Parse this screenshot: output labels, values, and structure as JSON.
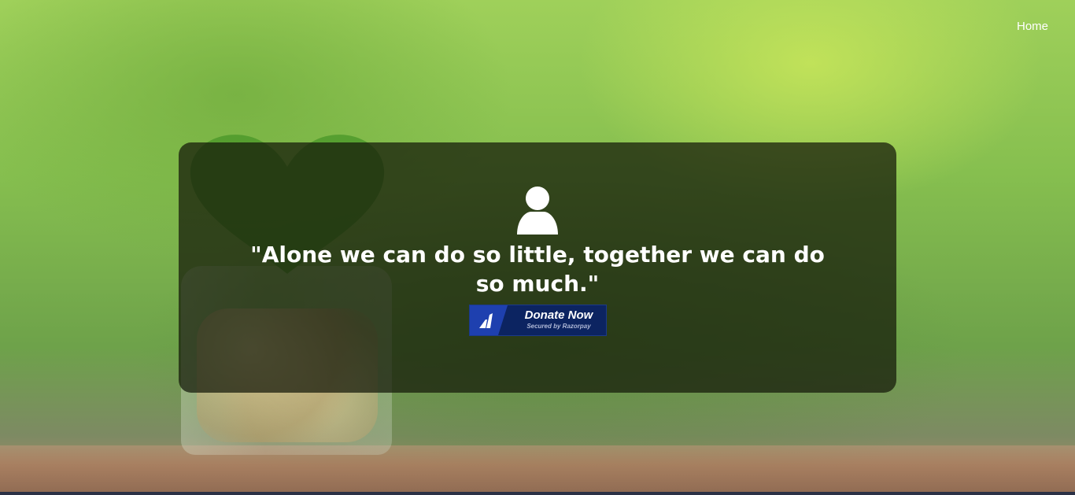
{
  "nav": {
    "home_label": "Home"
  },
  "hero": {
    "icon": "user-icon",
    "quote": "\"Alone we can do so little, together we can do so much.\"",
    "donate_button": {
      "label": "Donate Now",
      "sublabel": "Secured by Razorpay",
      "logo_icon": "razorpay-icon"
    }
  },
  "colors": {
    "card_overlay": "#14180a",
    "button_bg": "#0c2461",
    "logo_bg": "#1e40af",
    "text": "#ffffff"
  }
}
